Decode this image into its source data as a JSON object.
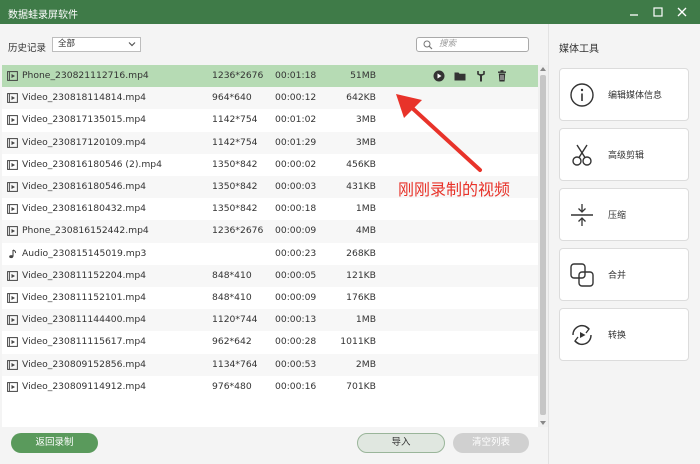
{
  "window": {
    "title": "数据蛙录屏软件",
    "controls": [
      "minimize-icon",
      "maximize-icon",
      "close-icon"
    ]
  },
  "history": {
    "label": "历史记录",
    "filter_value": "全部"
  },
  "search": {
    "placeholder": "搜索"
  },
  "files": [
    {
      "name": "Phone_230821112716.mp4",
      "resolution": "1236*2676",
      "duration": "00:01:18",
      "size": "51MB",
      "type": "video"
    },
    {
      "name": "Video_230818114814.mp4",
      "resolution": "964*640",
      "duration": "00:00:12",
      "size": "642KB",
      "type": "video"
    },
    {
      "name": "Video_230817135015.mp4",
      "resolution": "1142*754",
      "duration": "00:01:02",
      "size": "3MB",
      "type": "video"
    },
    {
      "name": "Video_230817120109.mp4",
      "resolution": "1142*754",
      "duration": "00:01:29",
      "size": "3MB",
      "type": "video"
    },
    {
      "name": "Video_230816180546 (2).mp4",
      "resolution": "1350*842",
      "duration": "00:00:02",
      "size": "456KB",
      "type": "video"
    },
    {
      "name": "Video_230816180546.mp4",
      "resolution": "1350*842",
      "duration": "00:00:03",
      "size": "431KB",
      "type": "video"
    },
    {
      "name": "Video_230816180432.mp4",
      "resolution": "1350*842",
      "duration": "00:00:18",
      "size": "1MB",
      "type": "video"
    },
    {
      "name": "Phone_230816152442.mp4",
      "resolution": "1236*2676",
      "duration": "00:00:09",
      "size": "4MB",
      "type": "video"
    },
    {
      "name": "Audio_230815145019.mp3",
      "resolution": "",
      "duration": "00:00:23",
      "size": "268KB",
      "type": "audio"
    },
    {
      "name": "Video_230811152204.mp4",
      "resolution": "848*410",
      "duration": "00:00:05",
      "size": "121KB",
      "type": "video"
    },
    {
      "name": "Video_230811152101.mp4",
      "resolution": "848*410",
      "duration": "00:00:09",
      "size": "176KB",
      "type": "video"
    },
    {
      "name": "Video_230811144400.mp4",
      "resolution": "1120*744",
      "duration": "00:00:13",
      "size": "1MB",
      "type": "video"
    },
    {
      "name": "Video_230811115617.mp4",
      "resolution": "962*642",
      "duration": "00:00:28",
      "size": "1011KB",
      "type": "video"
    },
    {
      "name": "Video_230809152856.mp4",
      "resolution": "1134*764",
      "duration": "00:00:53",
      "size": "2MB",
      "type": "video"
    },
    {
      "name": "Video_230809114912.mp4",
      "resolution": "976*480",
      "duration": "00:00:16",
      "size": "701KB",
      "type": "video"
    }
  ],
  "selected_index": 0,
  "row_actions": [
    "play-icon",
    "folder-icon",
    "wrench-icon",
    "trash-icon"
  ],
  "annotation": "刚刚录制的视频",
  "buttons": {
    "back": "返回录制",
    "import": "导入",
    "clear": "清空列表"
  },
  "media_tools": {
    "title": "媒体工具",
    "items": [
      {
        "label": "编辑媒体信息",
        "icon": "info-icon"
      },
      {
        "label": "高级剪辑",
        "icon": "scissors-icon"
      },
      {
        "label": "压缩",
        "icon": "compress-icon"
      },
      {
        "label": "合并",
        "icon": "merge-icon"
      },
      {
        "label": "转换",
        "icon": "convert-icon"
      }
    ]
  },
  "colors": {
    "titlebar": "#3f7b48",
    "selected_row": "#b6dbb4",
    "accent": "#5a9a5c",
    "annotation": "#e8332a"
  }
}
